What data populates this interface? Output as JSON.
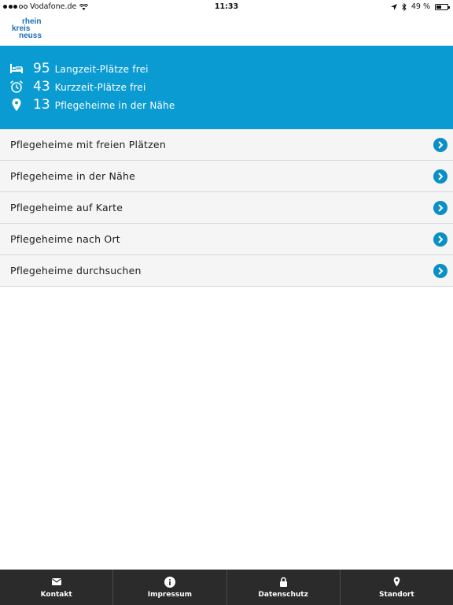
{
  "status_bar": {
    "carrier": "Vodafone.de",
    "time": "11:33",
    "battery_text": "49 %",
    "battery_level": 0.49
  },
  "header": {
    "logo_line1": "rhein",
    "logo_line2": "kreis",
    "logo_line3": "neuss",
    "brand_color": "#1a6fb5"
  },
  "stats": {
    "background_color": "#0b9bd3",
    "items": [
      {
        "icon": "bed-icon",
        "value": "95",
        "label": "Langzeit-Plätze frei"
      },
      {
        "icon": "alarm-clock-icon",
        "value": "43",
        "label": "Kurzzeit-Plätze frei"
      },
      {
        "icon": "location-pin-icon",
        "value": "13",
        "label": "Pflegeheime in der Nähe"
      }
    ]
  },
  "menu": {
    "items": [
      {
        "label": "Pflegeheime mit freien Plätzen"
      },
      {
        "label": "Pflegeheime in der Nähe"
      },
      {
        "label": "Pflegeheime auf Karte"
      },
      {
        "label": "Pflegeheime nach Ort"
      },
      {
        "label": "Pflegeheime durchsuchen"
      }
    ],
    "chevron_icon": "chevron-right-circle-icon"
  },
  "tabbar": {
    "tabs": [
      {
        "icon": "envelope-icon",
        "label": "Kontakt"
      },
      {
        "icon": "info-icon",
        "label": "Impressum"
      },
      {
        "icon": "lock-icon",
        "label": "Datenschutz"
      },
      {
        "icon": "location-pin-icon",
        "label": "Standort"
      }
    ]
  }
}
